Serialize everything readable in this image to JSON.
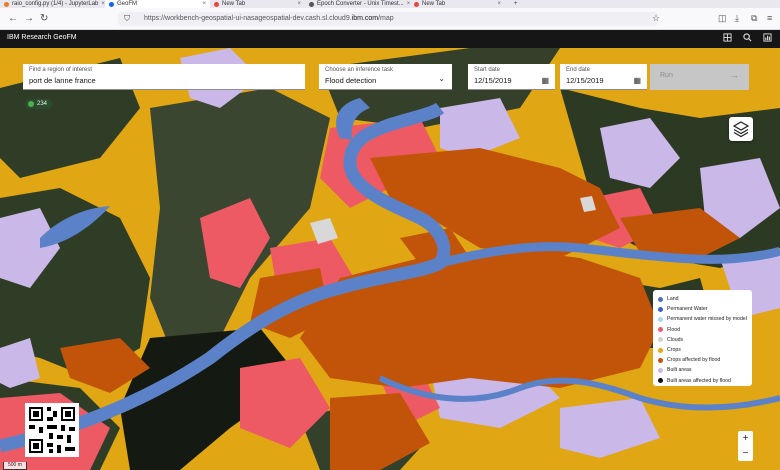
{
  "browser": {
    "tabs": [
      {
        "label": "raio_config.py (1/4) - JupyterLab",
        "favicon_color": "#f37726",
        "active": false
      },
      {
        "label": "GeoFM",
        "favicon_color": "#0f62fe",
        "active": true
      },
      {
        "label": "New Tab",
        "favicon_color": "#e8453c",
        "active": false
      },
      {
        "label": "Epoch Converter - Unix Timest...",
        "favicon_color": "#555555",
        "active": false
      },
      {
        "label": "New Tab",
        "favicon_color": "#e8453c",
        "active": false
      }
    ],
    "url_prefix": "https://workbench-geospatial-ui-nasageospatial-dev.cash.sl.cloud9.",
    "url_domain": "ibm.com",
    "url_suffix": "/map"
  },
  "app": {
    "title": "IBM Research GeoFM",
    "header_icons": [
      "grid-icon",
      "search-icon",
      "chart-icon"
    ]
  },
  "form": {
    "region": {
      "label": "Find a region of interest",
      "value": "port de lanne france"
    },
    "task": {
      "label": "Choose an inference task",
      "value": "Flood detection"
    },
    "start_date": {
      "label": "Start date",
      "value": "12/15/2019"
    },
    "end_date": {
      "label": "End date",
      "value": "12/15/2019"
    },
    "run_label": "Run"
  },
  "badge": {
    "label": "234"
  },
  "legend": [
    {
      "label": "Land",
      "color": "#4a6fb5"
    },
    {
      "label": "Permanent Water",
      "color": "#3b63c7"
    },
    {
      "label": "Permanent water missed by model",
      "color": "#a9d6f5"
    },
    {
      "label": "Flood",
      "color": "#f25c6b"
    },
    {
      "label": "Clouds",
      "color": "#d0d0d0"
    },
    {
      "label": "Crops",
      "color": "#e6a817"
    },
    {
      "label": "Crops affected by flood",
      "color": "#c2540a"
    },
    {
      "label": "Built areas",
      "color": "#c9b8e8"
    },
    {
      "label": "Built areas affected by flood",
      "color": "#111111"
    }
  ],
  "map": {
    "zoom_in": "+",
    "zoom_out": "−",
    "scale_label": "500 m"
  },
  "colors": {
    "crops": "#e0a613",
    "crops_flood": "#c2540a",
    "water": "#5b82c8",
    "flood": "#ee5a64",
    "built": "#c9b8e8",
    "forest": "#2f3d27"
  }
}
